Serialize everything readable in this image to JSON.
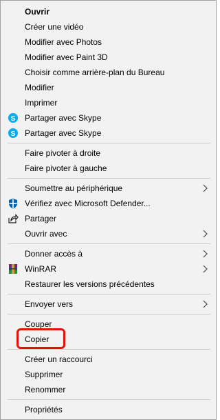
{
  "menu": {
    "items": [
      {
        "label": "Ouvrir"
      },
      {
        "label": "Créer une vidéo"
      },
      {
        "label": "Modifier avec Photos"
      },
      {
        "label": "Modifier avec Paint 3D"
      },
      {
        "label": "Choisir comme arrière-plan du Bureau"
      },
      {
        "label": "Modifier"
      },
      {
        "label": "Imprimer"
      },
      {
        "label": "Partager avec Skype",
        "icon": "skype-icon"
      },
      {
        "label": "Partager avec Skype",
        "icon": "skype-icon"
      },
      {
        "label": "Faire pivoter à droite"
      },
      {
        "label": "Faire pivoter à gauche"
      },
      {
        "label": "Soumettre au périphérique",
        "has_submenu": true
      },
      {
        "label": "Vérifiez avec Microsoft Defender...",
        "icon": "defender-shield-icon"
      },
      {
        "label": "Partager",
        "icon": "share-icon"
      },
      {
        "label": "Ouvrir avec",
        "has_submenu": true
      },
      {
        "label": "Donner accès à",
        "has_submenu": true
      },
      {
        "label": "WinRAR",
        "icon": "winrar-icon",
        "has_submenu": true
      },
      {
        "label": "Restaurer les versions précédentes"
      },
      {
        "label": "Envoyer vers",
        "has_submenu": true
      },
      {
        "label": "Couper"
      },
      {
        "label": "Copier",
        "highlighted": true
      },
      {
        "label": "Créer un raccourci"
      },
      {
        "label": "Supprimer"
      },
      {
        "label": "Renommer"
      },
      {
        "label": "Propriétés"
      }
    ]
  },
  "colors": {
    "menu_background": "#f2f2f2",
    "separator": "#c8c8c8",
    "highlight_box": "#e3120b",
    "skype_blue": "#00aff0",
    "defender_blue": "#0063b1"
  }
}
